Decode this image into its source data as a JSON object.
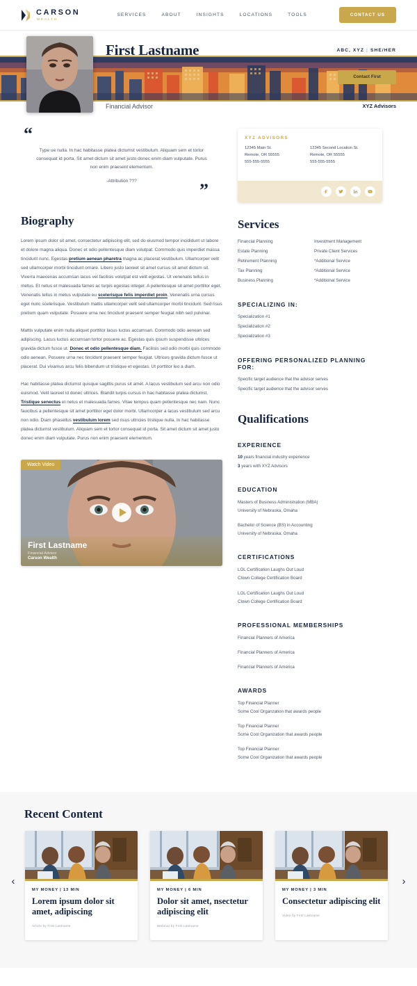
{
  "nav": {
    "logo_name": "CARSON",
    "logo_sub": "WEALTH",
    "links": [
      "SERVICES",
      "ABOUT",
      "INSIGHTS",
      "LOCATIONS",
      "TOOLS"
    ],
    "contact_label": "CONTACT US"
  },
  "hero": {
    "name": "First Lastname",
    "credentials": "ABC, XYZ",
    "pronouns": "SHE/HER",
    "contact_button": "Contact First",
    "role": "Financial Advisor",
    "firm": "XYZ Advisors"
  },
  "quote": {
    "text": "Type ue nulla. In hac habitasse platea dictumst vestibulum. Aliquam sem et tortor consequat id porta. Sit amet dictum sit amet justo donec enim diam vulputate. Purus non enim praesent elementum.",
    "attribution": "-Attribution ???",
    "open_mark": "“",
    "close_mark": "”"
  },
  "advisor_card": {
    "title": "XYZ ADVISORS",
    "locations": [
      {
        "street": "12345 Main St.",
        "city": "Remote, OR 55555",
        "phone": "555-555-5555"
      },
      {
        "street": "12345 Second Location St.",
        "city": "Remote, OR 55555",
        "phone": "555-555-5555"
      }
    ],
    "social": [
      "facebook-icon",
      "twitter-icon",
      "linkedin-icon",
      "youtube-icon"
    ]
  },
  "biography": {
    "heading": "Biography",
    "paragraphs": [
      {
        "parts": [
          {
            "t": "Lorem ipsum dolor sit amet, consectetur adipiscing elit, sed do eiusmod tempor incididunt ut labore et dolore magna aliqua. Donec et odio pellentesque diam volutpat. Commodo quis imperdiet massa tincidunt nunc. Egestas ",
            "b": false
          },
          {
            "t": "pretium aenean pharetra",
            "b": true
          },
          {
            "t": " magna ac placerat vestibulum. Ullamcorper velit sed ullamcorper morbi tincidunt ornare. Libero justo laoreet sit amet cursus sit amet dictum sit. Viverra maecenas accumsan lacus vel facilisis volutpat est velit egestas. Ut venenatis tellus in metus. Et netus et malesuada fames ac turpis egestas integer. A pellentesque sit amet porttitor eget. Venenatis tellus in metus vulputate eu ",
            "b": false
          },
          {
            "t": "scelerisque felis imperdiet proin",
            "b": true
          },
          {
            "t": ". Venenatis urna cursus eget nunc scelerisque. Vestibulum mattis ullamcorper velit sed ullamcorper morbi tincidunt. Sed risus pretium quam vulputate. Posuere urna nec tincidunt praesent semper feugiat nibh sed pulvinar.",
            "b": false
          }
        ]
      },
      {
        "parts": [
          {
            "t": "Mattis vulputate enim nulla aliquet porttitor lacus luctus accumsan. Commodo odio aenean sed adipiscing. Lacus luctus accumsan tortor posuere ac. Egestas quis ipsum suspendisse ultrices gravida dictum fusce ut. ",
            "b": false
          },
          {
            "t": "Donec et odio pellentesque diam.",
            "b": true
          },
          {
            "t": " Facilisis sed odio morbi quis commodo odio aenean. Posuere urna nec tincidunt praesent semper feugiat. Ultrices gravida dictum fusce ut placerat. Dui vivamus arcu felis bibendum ut tristique et egestas. Ut porttitor leo a diam.",
            "b": false
          }
        ]
      },
      {
        "parts": [
          {
            "t": "Hac habitasse platea dictumst quisque sagittis purus sit amet. A lacus vestibulum sed arcu non odio euismod. Velit laoreet id donec ultrices. Blandit turpis cursus in hac habitasse platea dictumst. ",
            "b": false
          },
          {
            "t": "Tristique senectus",
            "b": true
          },
          {
            "t": " et netus et malesuada fames. Vitae tempus quam pellentesque nec nam. Nunc faucibus a pellentesque sit amet porttitor eget dolor morbi. Ullamcorper a lacus vestibulum sed arcu non odio. Diam phasellus ",
            "b": false
          },
          {
            "t": "vestibulum lorem",
            "b": true
          },
          {
            "t": " sed risus ultricies tristique nulla. In hac habitasse platea dictumst vestibulum. Aliquam sem et tortor consequat id porta. Sit amet dictum sit amet justo donec enim diam vulputate. Purus non enim praesent elementum.",
            "b": false
          }
        ]
      }
    ]
  },
  "video": {
    "badge": "Watch Video",
    "name": "First Lastname",
    "role": "Financial Advisor",
    "firm": "Carson Wealth",
    "play_icon": "play-icon"
  },
  "services": {
    "heading": "Services",
    "column_one": [
      "Financial Planning",
      "Estate Planning",
      "Retirement Planning",
      "Tax Planning",
      "Business Planning"
    ],
    "column_two": [
      "Investment Management",
      "Private Client Services",
      "*Additional Service",
      "*Additional Service",
      "*Additional Service"
    ]
  },
  "specializing": {
    "heading": "SPECIALIZING IN:",
    "items": [
      "Specialization #1",
      "Specialization #2",
      "Specialization #3"
    ]
  },
  "planning_for": {
    "heading": "OFFERING PERSONALIZED PLANNING FOR:",
    "items": [
      "Specific target audience that the advisor serves",
      "Specific target audience that the advisor serves"
    ]
  },
  "qualifications": {
    "heading": "Qualifications",
    "experience": {
      "heading": "EXPERIENCE",
      "lines": [
        {
          "bold": "10",
          "rest": " years financial industry experience"
        },
        {
          "bold": "3",
          "rest": " years with XYZ Advisors"
        }
      ]
    },
    "education": {
      "heading": "EDUCATION",
      "groups": [
        [
          "Masters of Business Administration (MBA)",
          "University of Nebraska, Omaha"
        ],
        [
          "Bachelor of Science (BS) in Accounting",
          "University of Nebraska, Omaha"
        ]
      ]
    },
    "certifications": {
      "heading": "CERTIFICATIONS",
      "groups": [
        [
          "LOL Certification Laughs Out Loud",
          "Clown College Certification Board"
        ],
        [
          "LOL Certification Laughs Out Loud",
          "Clown College Certification Board"
        ]
      ]
    },
    "memberships": {
      "heading": "PROFESSIONAL MEMBERSHIPS",
      "groups": [
        [
          "Financial Planners of America"
        ],
        [
          "Financial Planners of America"
        ],
        [
          "Financial Planners of America"
        ]
      ]
    },
    "awards": {
      "heading": "AWARDS",
      "groups": [
        [
          "Top Financial Planner",
          "Some Cool Organzation that awards people"
        ],
        [
          "Top Financial Planner",
          "Some Cool Organization that awards people"
        ],
        [
          "Top Financial Planner",
          "Some Cool Organization that awards people"
        ]
      ]
    }
  },
  "recent": {
    "heading": "Recent Content",
    "prev_icon": "chevron-left-icon",
    "next_icon": "chevron-right-icon",
    "cards": [
      {
        "kicker": "MY MONEY | 13 MIN",
        "title": "Lorem ipsum dolor sit amet,  adipiscing",
        "byline": "Article by First Lastname"
      },
      {
        "kicker": "MY MONEY | 6 MIN",
        "title": "Dolor sit amet, nsectetur adipiscing elit",
        "byline": "Webinar by First Lastname"
      },
      {
        "kicker": "MY MONEY | 3 MIN",
        "title": "Consectetur adipiscing elit",
        "byline": "Video by First Lastname"
      }
    ]
  },
  "colors": {
    "gold": "#c9a84c",
    "navy": "#16253f",
    "cream": "#f2e8cf",
    "body": "#4a5566"
  }
}
